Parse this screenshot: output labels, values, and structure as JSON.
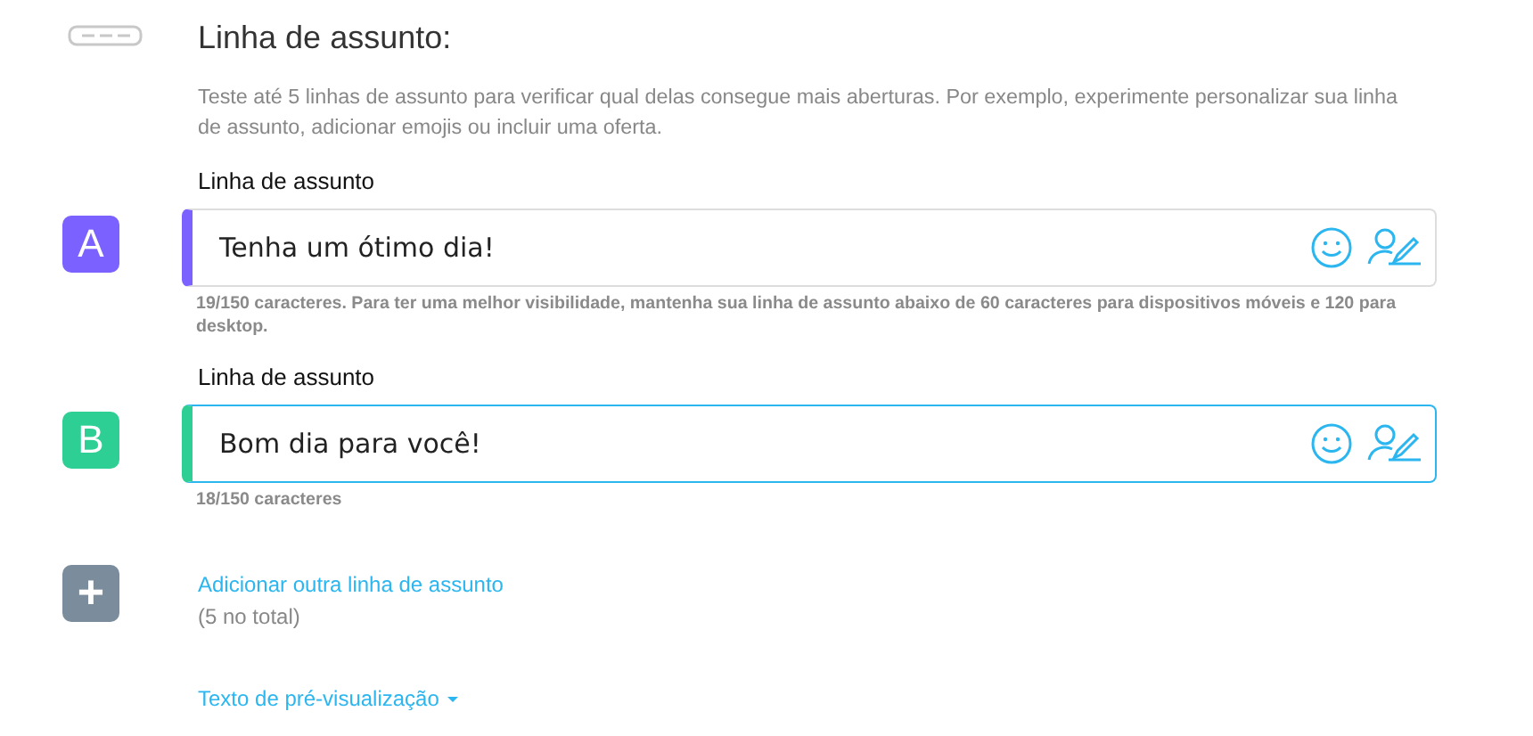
{
  "section": {
    "title": "Linha de assunto:",
    "description": "Teste até 5 linhas de assunto para verificar qual delas consegue mais aberturas. Por exemplo, experimente personalizar sua linha de assunto, adicionar emojis ou incluir uma oferta."
  },
  "subject_lines": [
    {
      "letter": "A",
      "color": "#7b61ff",
      "label": "Linha de assunto",
      "value": "Tenha um ótimo dia!",
      "focused": false,
      "hint": "19/150 caracteres. Para ter uma melhor visibilidade, mantenha sua linha de assunto abaixo de 60 caracteres para dispositivos móveis e 120 para desktop."
    },
    {
      "letter": "B",
      "color": "#2ecf94",
      "label": "Linha de assunto",
      "value": "Bom dia para você!",
      "focused": true,
      "hint": "18/150 caracteres"
    }
  ],
  "add_line": {
    "plus": "+",
    "link": "Adicionar outra linha de assunto",
    "note": "(5 no total)"
  },
  "preview_link": "Texto de pré-visualização"
}
